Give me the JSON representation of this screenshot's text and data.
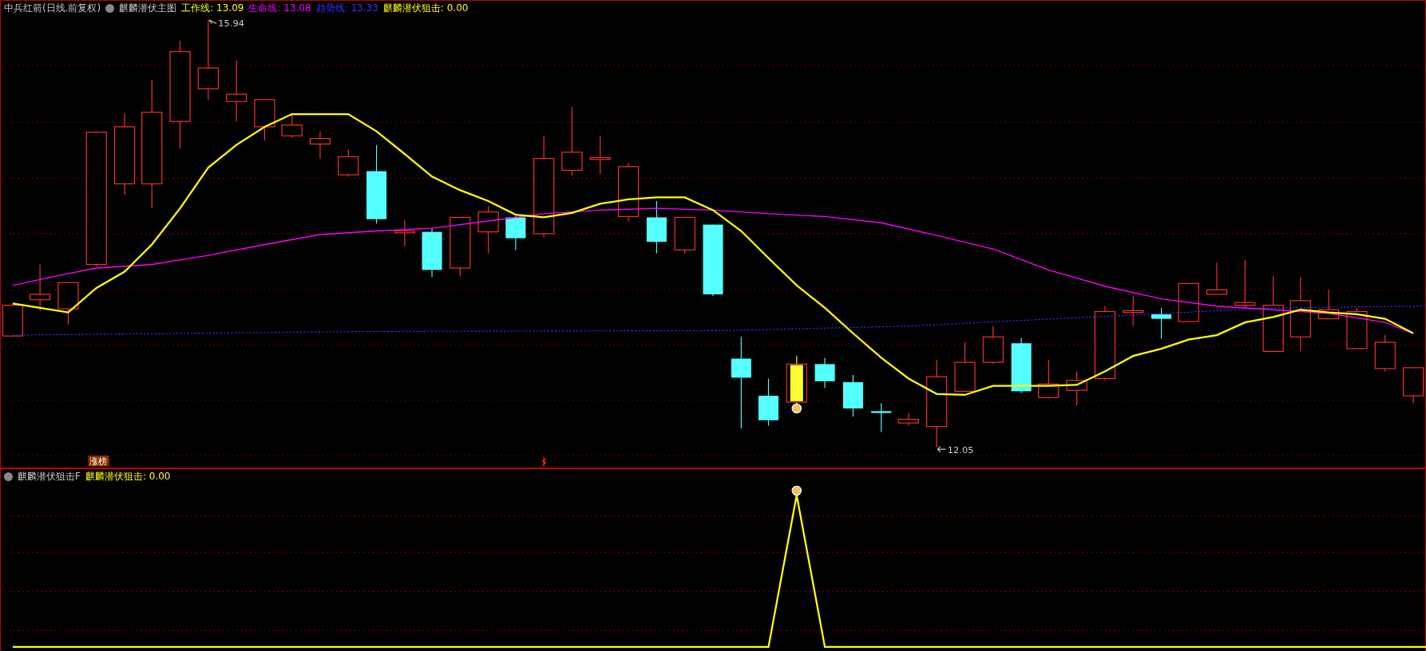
{
  "main_panel": {
    "title": "中兵红箭(日线.前复权)",
    "indicator": "麒麟潜伏主图",
    "legend": [
      {
        "text": "工作线: 13.09",
        "color": "#ffff00"
      },
      {
        "text": "生命线: 13.08",
        "color": "#ff00ff"
      },
      {
        "text": "趋势线: 13.33",
        "color": "#3333ff"
      },
      {
        "text": "麒麟潜伏狙击: 0.00",
        "color": "#ffff00"
      }
    ],
    "high_label": "15.94",
    "low_label": "12.05",
    "badge": "涨榜"
  },
  "sub_panel": {
    "indicator": "麒麟潜伏狙击F",
    "legend": [
      {
        "text": "麒麟潜伏狙击: 0.00",
        "color": "#ffff00"
      }
    ]
  }
}
